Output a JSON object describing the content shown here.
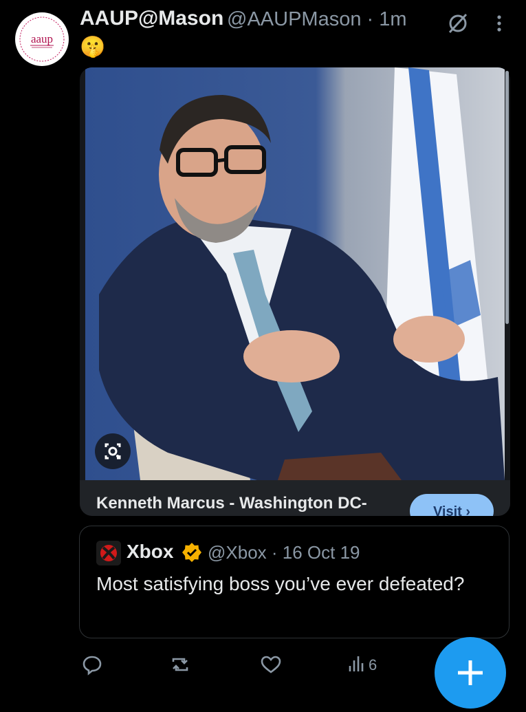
{
  "tweet": {
    "display_name": "AAUP@Mason",
    "handle_time": "@AAUPMason · 1m",
    "text": "🤫",
    "avatar_text": "aaup"
  },
  "card": {
    "title": "Kenneth Marcus - Washington DC-",
    "visit_label": "Visit ›"
  },
  "quote": {
    "name": "Xbox",
    "handle_time": "@Xbox · 16 Oct 19",
    "text": "Most satisfying boss you’ve ever defeated?"
  },
  "actions": {
    "views": "6"
  },
  "colors": {
    "background": "#000000",
    "text": "#e7e9ea",
    "muted": "#8b98a5",
    "accent": "#1d9bf0",
    "verified": "#f6b100"
  }
}
